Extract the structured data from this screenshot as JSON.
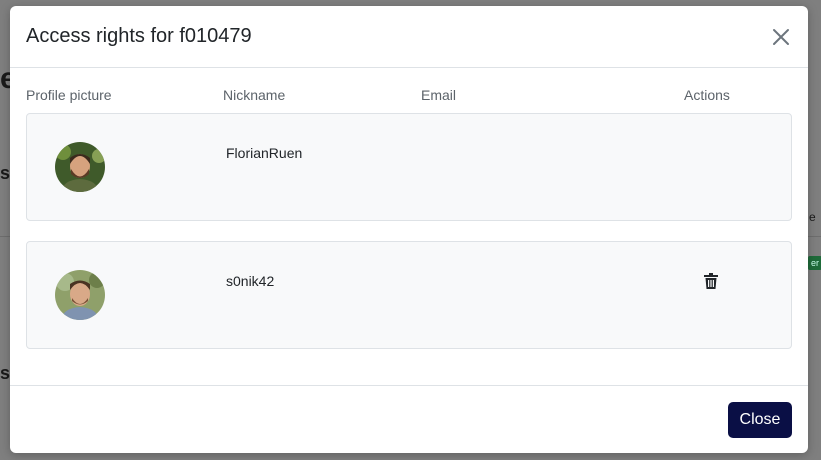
{
  "modal": {
    "title": "Access rights for f010479",
    "close_label": "Close"
  },
  "table": {
    "headers": [
      "Profile picture",
      "Nickname",
      "Email",
      "Actions"
    ],
    "rows": [
      {
        "nickname": "FlorianRuen",
        "email": "",
        "deletable": false
      },
      {
        "nickname": "s0nik42",
        "email": "",
        "deletable": true
      }
    ]
  },
  "icons": {
    "close": "close-icon",
    "delete": "trash-icon"
  },
  "colors": {
    "primary_button": "#0a0f45",
    "row_background": "#f8f9fa",
    "border": "#dee2e6"
  }
}
